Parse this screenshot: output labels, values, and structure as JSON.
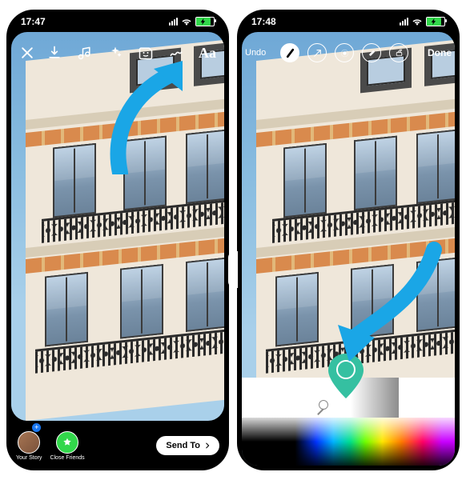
{
  "annotation_color": "#1aa6e6",
  "left_phone": {
    "status_time": "17:47",
    "tools": {
      "download": "download-icon",
      "music": "music-icon",
      "effects": "sparkle-icon",
      "sticker": "sticker-icon",
      "draw": "squiggle-icon",
      "text_label": "Aa"
    },
    "bottom": {
      "your_story_label": "Your Story",
      "close_friends_label": "Close Friends",
      "send_to_label": "Send To"
    }
  },
  "right_phone": {
    "status_time": "17:48",
    "toolbar": {
      "undo_label": "Undo",
      "done_label": "Done",
      "brush_tools": [
        "marker",
        "arrow",
        "glow",
        "chisel",
        "eraser"
      ]
    },
    "picker": {
      "selected_color": "#35c0a1"
    }
  }
}
